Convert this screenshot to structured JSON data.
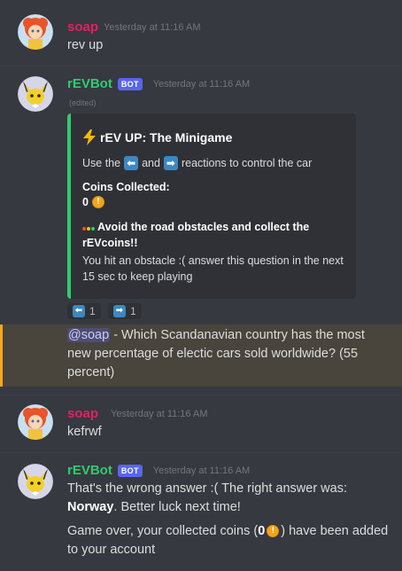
{
  "messages": {
    "m1": {
      "author": "soap",
      "timestamp": "Yesterday at 11:16 AM",
      "text": "rev up"
    },
    "m2": {
      "author": "rEVBot",
      "badge": "BOT",
      "timestamp": "Yesterday at 11:16 AM",
      "edited": "(edited)",
      "embed": {
        "title": "rEV UP: The Minigame",
        "controls_pre": "Use the",
        "controls_mid": "and",
        "controls_post": "reactions to control the car",
        "coins_label": "Coins Collected:",
        "coins_value": "0",
        "objective": "Avoid the road obstacles and collect the rEVcoins!!",
        "description": "You hit an obstacle :( answer this question in the next 15 sec to keep playing",
        "accent_color": "#2ecc71"
      },
      "reactions": [
        {
          "icon": "left-arrow-icon",
          "count": "1"
        },
        {
          "icon": "right-arrow-icon",
          "count": "1"
        }
      ],
      "followup": {
        "mention": "@soap",
        "text": " - Which Scandanavian country has the most new percentage of electic cars sold worldwide? (55 percent)"
      }
    },
    "m3": {
      "author": "soap",
      "timestamp": "Yesterday at 11:16 AM",
      "text": "kefrwf"
    },
    "m4": {
      "author": "rEVBot",
      "badge": "BOT",
      "timestamp": "Yesterday at 11:16 AM",
      "line1_pre": "That's the wrong answer :( The right answer was: ",
      "answer": "Norway",
      "line1_post": ". Better luck next time!",
      "line2_pre": "Game over, your collected coins (",
      "coins": "0",
      "line2_post": ") have been added to your account"
    }
  },
  "colors": {
    "background": "#36393f",
    "soap_name": "#e91e63",
    "bot_name": "#2ecc71",
    "bot_badge": "#5865f2",
    "mention_highlight": "#49443c",
    "mention_bar": "#faa81a"
  }
}
